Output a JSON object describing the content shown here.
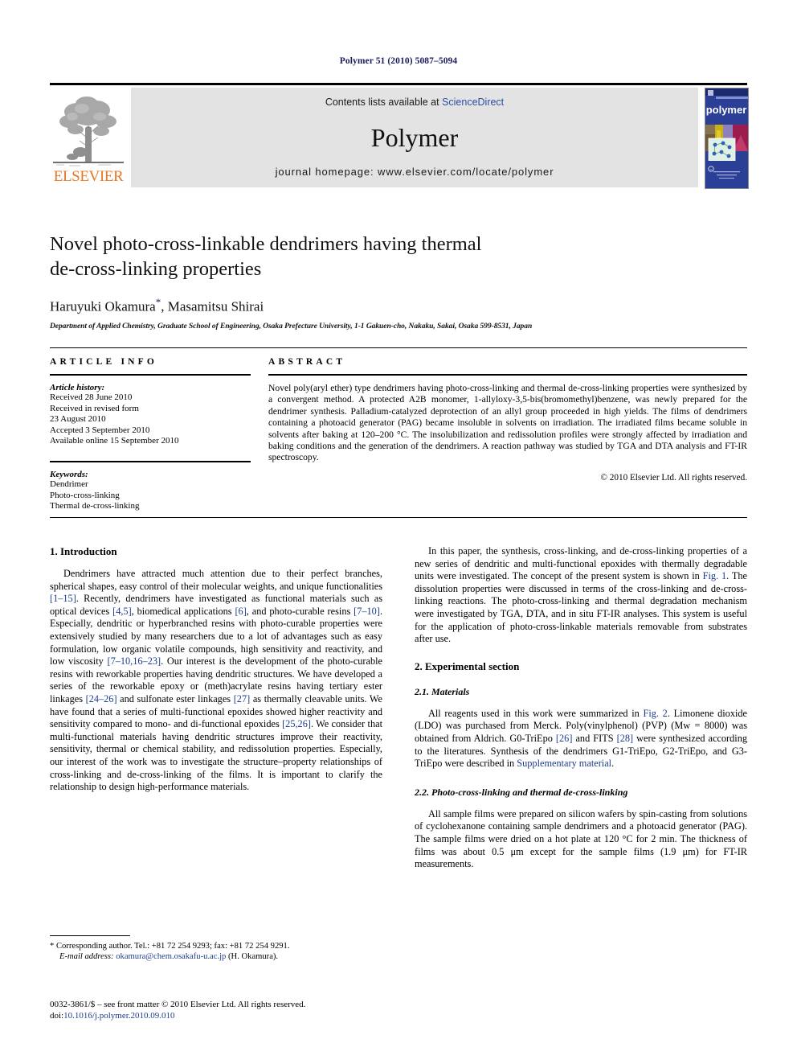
{
  "running_head": "Polymer 51 (2010) 5087–5094",
  "masthead": {
    "publisher_name": "ELSEVIER",
    "contents_prefix": "Contents lists available at ",
    "sciencedirect_link": "ScienceDirect",
    "journal_title": "Polymer",
    "homepage_line": "journal homepage: www.elsevier.com/locate/polymer",
    "cover_label": "polymer",
    "accent_orange": "#E87722",
    "accent_blue": "#2b4ea2",
    "cover_blue": "#2b3f97",
    "banner_gray": "#e3e3e3"
  },
  "title": {
    "line1": "Novel photo-cross-linkable dendrimers having thermal",
    "line2": "de-cross-linking properties"
  },
  "authors": {
    "text": "Haruyuki Okamura",
    "corresponding_marker": "*",
    "text_after": ", Masamitsu Shirai"
  },
  "affiliation": "Department of Applied Chemistry, Graduate School of Engineering, Osaka Prefecture University, 1-1 Gakuen-cho, Nakaku, Sakai, Osaka 599-8531, Japan",
  "article_info": {
    "heading": "ARTICLE INFO",
    "history_label": "Article history:",
    "history_lines": [
      "Received 28 June 2010",
      "Received in revised form",
      "23 August 2010",
      "Accepted 3 September 2010",
      "Available online 15 September 2010"
    ],
    "keywords_label": "Keywords:",
    "keywords": [
      "Dendrimer",
      "Photo-cross-linking",
      "Thermal de-cross-linking"
    ]
  },
  "abstract": {
    "heading": "ABSTRACT",
    "body": "Novel poly(aryl ether) type dendrimers having photo-cross-linking and thermal de-cross-linking properties were synthesized by a convergent method. A protected A2B monomer, 1-allyloxy-3,5-bis(bromomethyl)benzene, was newly prepared for the dendrimer synthesis. Palladium-catalyzed deprotection of an allyl group proceeded in high yields. The films of dendrimers containing a photoacid generator (PAG) became insoluble in solvents on irradiation. The irradiated films became soluble in solvents after baking at 120–200 °C. The insolubilization and redissolution profiles were strongly affected by irradiation and baking conditions and the generation of the dendrimers. A reaction pathway was studied by TGA and DTA analysis and FT-IR spectroscopy.",
    "copyright": "© 2010 Elsevier Ltd. All rights reserved."
  },
  "sections": {
    "introduction": {
      "number_title": "1. Introduction",
      "paragraph1_a": "Dendrimers have attracted much attention due to their perfect branches, spherical shapes, easy control of their molecular weights, and unique functionalities ",
      "ref_1_15": "[1–15]",
      "paragraph1_b": ". Recently, dendrimers have investigated as functional materials such as optical devices ",
      "ref_4_5": "[4,5]",
      "paragraph1_c": ", biomedical applications ",
      "ref_6": "[6]",
      "paragraph1_d": ", and photo-curable resins ",
      "ref_7_10": "[7–10]",
      "paragraph1_e": ". Especially, dendritic or hyperbranched resins with photo-curable properties were extensively studied by many researchers due to a lot of advantages such as easy formulation, low organic volatile compounds, high sensitivity and reactivity, and low viscosity ",
      "ref_7_10_16_23": "[7–10,16–23]",
      "paragraph1_f": ". Our interest is the development of the photo-curable resins with reworkable properties having dendritic structures. We have developed a series of the reworkable epoxy or (meth)acrylate resins having tertiary ester linkages ",
      "ref_24_26": "[24–26]",
      "paragraph1_g": " and sulfonate ester linkages ",
      "ref_27": "[27]",
      "paragraph1_h": " as thermally cleavable units. We have found that a series of multi-functional epoxides showed higher reactivity and sensitivity compared to mono- and di-functional epoxides ",
      "ref_25_26": "[25,26]",
      "paragraph1_i": ". We consider that multi-functional materials having dendritic structures improve their reactivity, sensitivity, thermal or chemical stability, and redissolution properties. Especially, our interest of the work was to investigate the structure–property relationships of cross-linking and de-cross-linking of the films. It is important to clarify the relationship to design high-performance materials.",
      "paragraph2_a": "In this paper, the synthesis, cross-linking, and de-cross-linking properties of a new series of dendritic and multi-functional epoxides with thermally degradable units were investigated. The concept of the present system is shown in ",
      "ref_fig1": "Fig. 1",
      "paragraph2_b": ". The dissolution properties were discussed in terms of the cross-linking and de-cross-linking reactions. The photo-cross-linking and thermal degradation mechanism were investigated by TGA, DTA, and in situ FT-IR analyses. This system is useful for the application of photo-cross-linkable materials removable from substrates after use."
    },
    "experimental": {
      "number_title": "2. Experimental section",
      "materials_title": "2.1. Materials",
      "materials_a": "All reagents used in this work were summarized in ",
      "ref_fig2": "Fig. 2",
      "materials_b": ". Limonene dioxide (LDO) was purchased from Merck. Poly(vinylphenol) (PVP) (Mw = 8000) was obtained from Aldrich. G0-TriEpo ",
      "ref_26": "[26]",
      "materials_c": " and FITS ",
      "ref_28": "[28]",
      "materials_d": " were synthesized according to the literatures. Synthesis of the dendrimers G1-TriEpo, G2-TriEpo, and G3-TriEpo were described in ",
      "supplementary_link": "Supplementary material",
      "materials_e": ".",
      "photo_title": "2.2. Photo-cross-linking and thermal de-cross-linking",
      "photo_body": "All sample films were prepared on silicon wafers by spin-casting from solutions of cyclohexanone containing sample dendrimers and a photoacid generator (PAG). The sample films were dried on a hot plate at 120 °C for 2 min. The thickness of films was about 0.5 μm except for the sample films (1.9 μm) for FT-IR measurements."
    }
  },
  "footnotes": {
    "corresponding": "* Corresponding author. Tel.: +81 72 254 9293; fax: +81 72 254 9291.",
    "email_label": "E-mail address:",
    "email": "okamura@chem.osakafu-u.ac.jp",
    "email_suffix": "(H. Okamura).",
    "issn_line": "0032-3861/$ – see front matter © 2010 Elsevier Ltd. All rights reserved.",
    "doi_prefix": "doi:",
    "doi": "10.1016/j.polymer.2010.09.010"
  }
}
